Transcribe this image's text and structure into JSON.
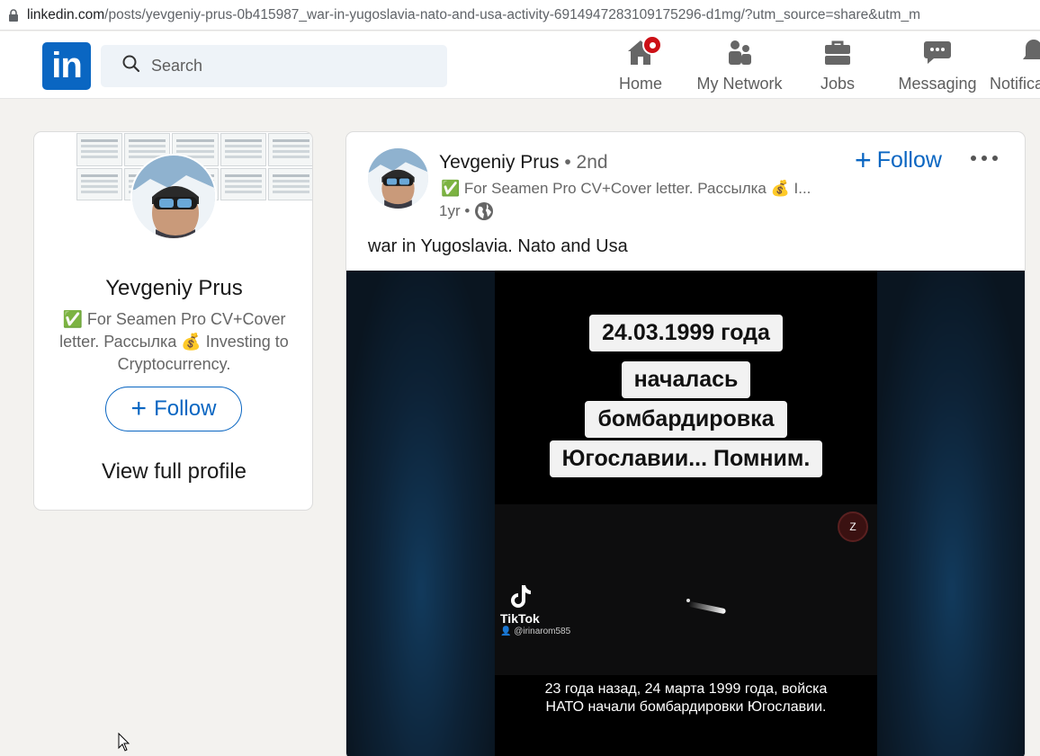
{
  "browser": {
    "url_host": "linkedin.com",
    "url_path": "/posts/yevgeniy-prus-0b415987_war-in-yugoslavia-nato-and-usa-activity-6914947283109175296-d1mg/?utm_source=share&utm_m"
  },
  "nav": {
    "logo": "in",
    "search_placeholder": "Search",
    "items": [
      {
        "label": "Home",
        "icon": "home-icon"
      },
      {
        "label": "My Network",
        "icon": "network-icon"
      },
      {
        "label": "Jobs",
        "icon": "briefcase-icon"
      },
      {
        "label": "Messaging",
        "icon": "messaging-icon"
      },
      {
        "label": "Notifica",
        "icon": "bell-icon"
      }
    ],
    "accent": "#0a66c2",
    "badge_color": "#cc1016"
  },
  "profile_card": {
    "name": "Yevgeniy Prus",
    "headline": "✅ For Seamen Pro CV+Cover letter. Рассылка 💰 Investing to Cryptocurrency.",
    "follow_label": "Follow",
    "view_profile": "View full profile"
  },
  "post": {
    "author": "Yevgeniy Prus",
    "degree": "• 2nd",
    "subhead": "✅ For Seamen Pro CV+Cover letter. Рассылка 💰 I...",
    "time": "1yr •",
    "follow_label": "Follow",
    "text": "war in Yugoslavia. Nato and Usa",
    "video": {
      "caption_lines": [
        "24.03.1999 года",
        "началась",
        "бомбардировка",
        "Югославии... Помним."
      ],
      "tiktok_label": "TikTok",
      "tiktok_user": "👤 @irinarom585",
      "badge": "Z",
      "subtitle_lines": [
        "23 года назад, 24 марта 1999 года, войска",
        "НАТО начали бомбардировки Югославии."
      ]
    }
  }
}
